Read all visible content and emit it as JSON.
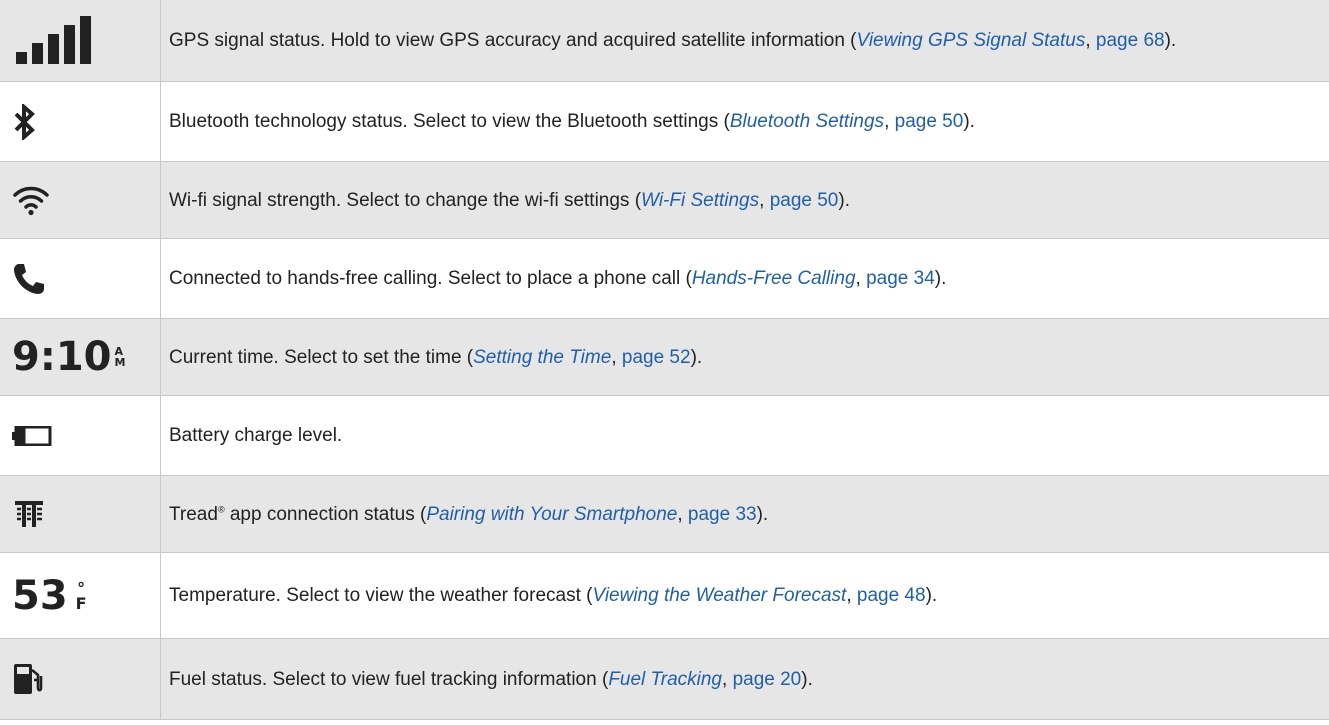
{
  "rows": [
    {
      "icon": "signal-bars-icon",
      "text": "GPS signal status. Hold to view GPS accuracy and acquired satellite information (",
      "link": "Viewing GPS Signal Status",
      "page": "page 68",
      "end": ")."
    },
    {
      "icon": "bluetooth-icon",
      "text": "Bluetooth technology status. Select to view the Bluetooth settings (",
      "link": "Bluetooth Settings",
      "page": "page 50",
      "end": ")."
    },
    {
      "icon": "wifi-icon",
      "text": "Wi-fi signal strength. Select to change the wi-fi settings (",
      "link": "Wi-Fi Settings",
      "page": "page 50",
      "end": ")."
    },
    {
      "icon": "phone-icon",
      "text": "Connected to hands-free calling. Select to place a phone call (",
      "link": "Hands-Free Calling",
      "page": "page 34",
      "end": ")."
    },
    {
      "icon": "clock-display-icon",
      "time": "9:10",
      "ampm_top": "A",
      "ampm_bottom": "M",
      "text": "Current time. Select to set the time (",
      "link": "Setting the Time",
      "page": "page 52",
      "end": ")."
    },
    {
      "icon": "battery-icon",
      "text": "Battery charge level."
    },
    {
      "icon": "tread-app-icon",
      "text_a": "Tread",
      "reg": "®",
      "text_b": " app connection status (",
      "link": "Pairing with Your Smartphone",
      "page": "page 33",
      "end": ")."
    },
    {
      "icon": "temperature-display-icon",
      "temp": "53",
      "deg": "°",
      "unit": "F",
      "text": "Temperature. Select to view the weather forecast (",
      "link": "Viewing the Weather Forecast",
      "page": "page 48",
      "end": ")."
    },
    {
      "icon": "fuel-pump-icon",
      "text": "Fuel status. Select to view fuel tracking information (",
      "link": "Fuel Tracking",
      "page": "page 20",
      "end": ")."
    }
  ],
  "separator": ", "
}
